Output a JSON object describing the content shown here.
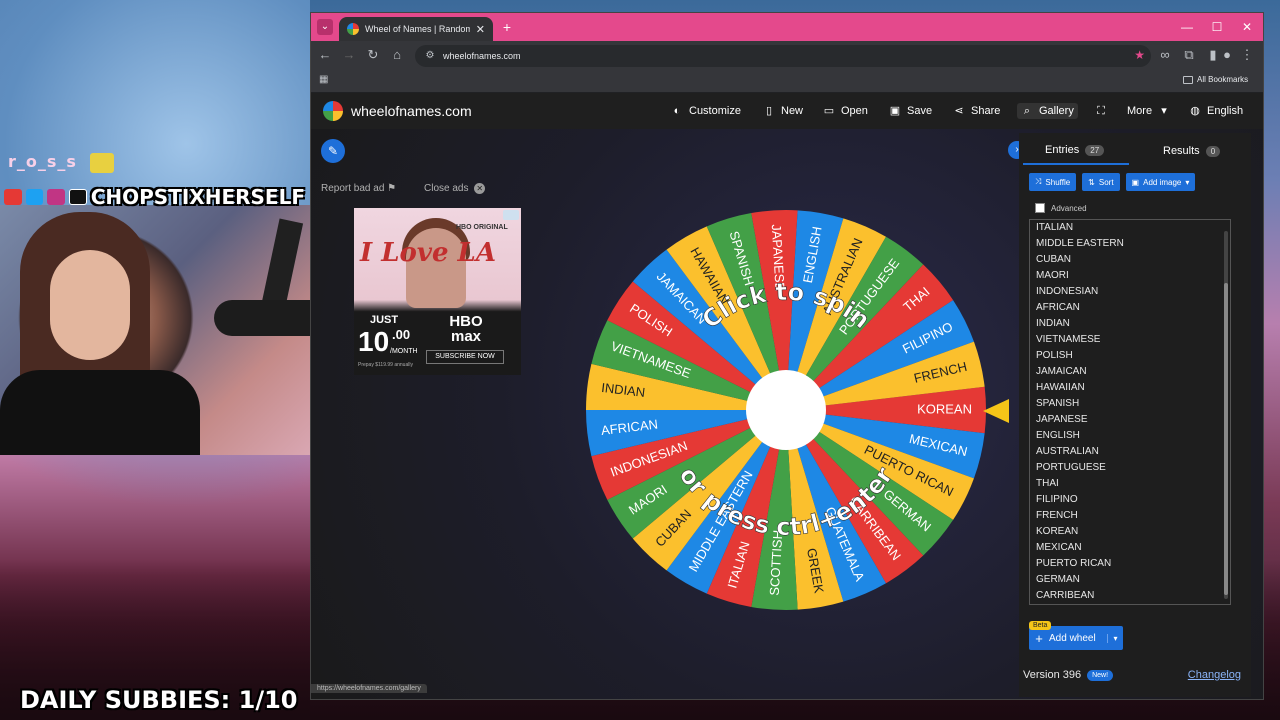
{
  "stream": {
    "overlay_name": "r_o_s_s",
    "handle": "CHOPSTIXHERSELF",
    "subbies": "DAILY SUBBIES: 1/10"
  },
  "browser": {
    "tab_title": "Wheel of Names | Random nam",
    "url": "wheelofnames.com",
    "all_bookmarks": "All Bookmarks",
    "status_url": "https://wheelofnames.com/gallery"
  },
  "app": {
    "logo_text": "wheelofnames.com",
    "menu": {
      "customize": "Customize",
      "new": "New",
      "open": "Open",
      "save": "Save",
      "share": "Share",
      "gallery": "Gallery",
      "more": "More",
      "language": "English"
    },
    "report_ad": "Report bad ad",
    "close_ads": "Close ads",
    "ad": {
      "hbo_original": "HBO ORIGINAL",
      "title": "I Love LA",
      "just": "JUST",
      "price": "10",
      "price_cents": ".00",
      "per_month": "/MONTH",
      "fineprint": "Prepay $119.99 annually",
      "brand": "HBO max",
      "cta": "SUBSCRIBE NOW"
    },
    "wheel": {
      "top_text": "Click to spin",
      "bottom_text": "or press ctrl+enter",
      "colors": [
        "#e53935",
        "#1e88e5",
        "#fbc02d",
        "#43a047"
      ],
      "slices": [
        "KOREAN",
        "MEXICAN",
        "PUERTO RICAN",
        "GERMAN",
        "CARRIBEAN",
        "GUATEMALA",
        "GREEK",
        "SCOTTISH",
        "ITALIAN",
        "MIDDLE EASTERN",
        "CUBAN",
        "MAORI",
        "INDONESIAN",
        "AFRICAN",
        "INDIAN",
        "VIETNAMESE",
        "POLISH",
        "JAMAICAN",
        "HAWAIIAN",
        "SPANISH",
        "JAPANESE",
        "ENGLISH",
        "AUSTRALIAN",
        "PORTUGUESE",
        "THAI",
        "FILIPINO",
        "FRENCH"
      ]
    },
    "sidebar": {
      "tab_entries": "Entries",
      "entries_count": "27",
      "tab_results": "Results",
      "results_count": "0",
      "shuffle": "Shuffle",
      "sort": "Sort",
      "add_image": "Add image",
      "advanced": "Advanced",
      "entries": [
        "ITALIAN",
        "MIDDLE EASTERN",
        "CUBAN",
        "MAORI",
        "INDONESIAN",
        "AFRICAN",
        "INDIAN",
        "VIETNAMESE",
        "POLISH",
        "JAMAICAN",
        "HAWAIIAN",
        "SPANISH",
        "JAPANESE",
        "ENGLISH",
        "AUSTRALIAN",
        "PORTUGUESE",
        "THAI",
        "FILIPINO",
        "FRENCH",
        "KOREAN",
        "MEXICAN",
        "PUERTO RICAN",
        "GERMAN",
        "CARRIBEAN"
      ],
      "beta": "Beta",
      "add_wheel": "Add wheel",
      "version": "Version 396",
      "new_badge": "New!",
      "changelog": "Changelog"
    }
  }
}
